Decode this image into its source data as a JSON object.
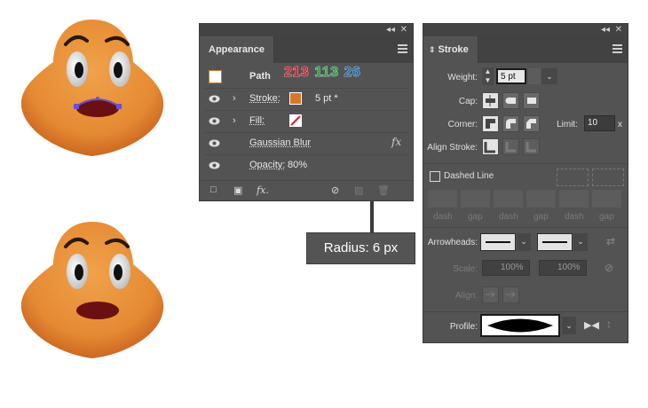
{
  "appearance": {
    "title": "Appearance",
    "rows": {
      "path": {
        "label": "Path",
        "swatch_color": "#ffffff"
      },
      "stroke": {
        "label": "Stroke:",
        "swatch_color": "#d5782a",
        "value": "5 pt *"
      },
      "fill": {
        "label": "Fill:"
      },
      "blur": {
        "label": "Gaussian Blur",
        "fx": "fx"
      },
      "opacity": {
        "label": "Opacity:",
        "value": "80%"
      }
    },
    "rgb": {
      "r": "213",
      "g": "113",
      "b": "26",
      "r_color": "#d81e2c",
      "g_color": "#2aa84a",
      "b_color": "#1e6fb5"
    },
    "footer": {
      "fx": "fx."
    }
  },
  "callout": {
    "text": "Radius: 6 px"
  },
  "stroke_panel": {
    "title": "Stroke",
    "weight_label": "Weight:",
    "weight_value": "5 pt",
    "cap_label": "Cap:",
    "corner_label": "Corner:",
    "limit_label": "Limit:",
    "limit_value": "10",
    "limit_unit": "x",
    "align_label": "Align Stroke:",
    "dashed_label": "Dashed Line",
    "dash_labels": [
      "dash",
      "gap",
      "dash",
      "gap",
      "dash",
      "gap"
    ],
    "arrowheads_label": "Arrowheads:",
    "scale_label": "Scale:",
    "scale_value_1": "100%",
    "scale_value_2": "100%",
    "align_arrows_label": "Align:",
    "profile_label": "Profile:"
  },
  "colors": {
    "skin": "#e8913a",
    "skin_dark": "#c96a22",
    "mouth": "#6b1010",
    "handles": "#6a4fd8"
  }
}
